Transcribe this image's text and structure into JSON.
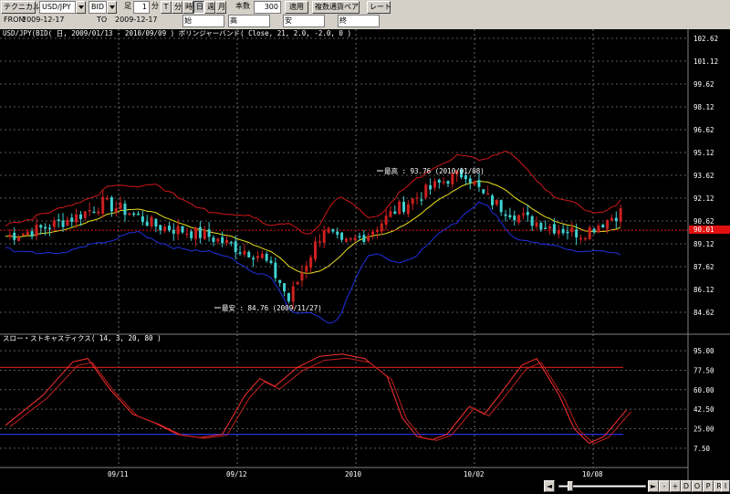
{
  "toolbar": {
    "technical_btn": "テクニカル",
    "pair": "USD/JPY",
    "side": "BID",
    "timeframe_label": "足",
    "minute_value": "1",
    "minute_unit": "分",
    "tick": "T",
    "minute": "分",
    "hour": "時",
    "day": "日",
    "week": "週",
    "month": "月",
    "count_label": "本数",
    "count_value": "300",
    "apply": "適用",
    "multi_currency": "複数通貨ペア",
    "rate": "レート",
    "from_label": "FROM",
    "from_date": "2009-12-17",
    "to_label": "TO",
    "to_date": "2009-12-17",
    "open": "始",
    "high": "高",
    "low": "安",
    "close": "終"
  },
  "main_panel": {
    "header": "USD/JPY(BID( 日, 2009/01/13 - 2010/09/09 )  ボリンジャーバンド( Close, 21, 2.0, -2.0, 0 )",
    "y_labels": [
      "102.62",
      "101.12",
      "99.62",
      "98.12",
      "96.62",
      "95.12",
      "93.62",
      "92.12",
      "90.62",
      "89.12",
      "87.62",
      "86.12",
      "84.62"
    ],
    "current_price": "90.01",
    "high_annotation": "最高 : 93.76 (2010/01/08)",
    "low_annotation": "最安 : 84.76 (2009/11/27)"
  },
  "sub_panel": {
    "header": "スロー・ストキャスティクス( 14, 3, 20, 80 )",
    "y_labels": [
      "95.00",
      "77.50",
      "60.00",
      "42.50",
      "25.00",
      "7.50"
    ]
  },
  "x_labels": [
    "09/11",
    "09/12",
    "2010",
    "10/02",
    "10/08"
  ],
  "nav_buttons": [
    "◄",
    "►",
    "-",
    "+",
    "D",
    "O",
    "P",
    "R",
    "I"
  ],
  "colors": {
    "bull": "#cc2020",
    "bear": "#40d0d0",
    "upper_band": "#d01818",
    "lower_band": "#2030e0",
    "middle_band": "#e8e020",
    "stoch_k": "#ff3030",
    "stoch_d": "#c02020",
    "level_high": "#c01818",
    "level_low": "#2030e0",
    "price_box": "#e01010"
  },
  "chart_data": {
    "type": "candlestick",
    "y_range_main": [
      84.62,
      102.62
    ],
    "y_range_sub": [
      0,
      100
    ],
    "stoch_levels": [
      80,
      20
    ],
    "high": 93.76,
    "low": 84.76,
    "current": 90.01
  }
}
